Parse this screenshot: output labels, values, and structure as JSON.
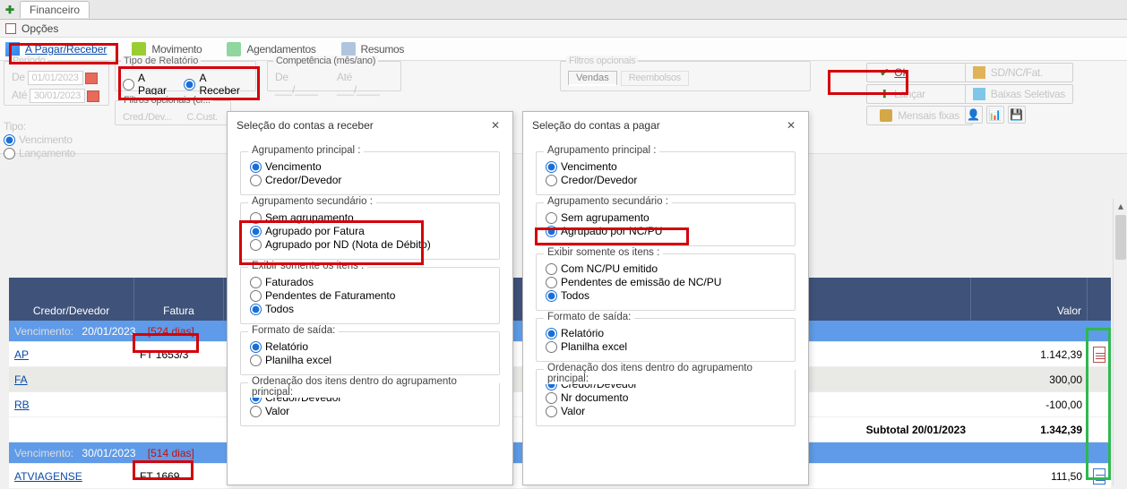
{
  "app": {
    "tab_title": "Financeiro"
  },
  "menu": {
    "opcoes": "Opções"
  },
  "toolbar": {
    "a_pagar_receber": "A Pagar/Receber",
    "movimento": "Movimento",
    "agendamentos": "Agendamentos",
    "resumos": "Resumos"
  },
  "filters": {
    "periodo_label": "Período",
    "de_label": "De",
    "ate_label": "Até",
    "tipo_label": "Tipo:",
    "de_value": "01/01/2023",
    "ate_value": "30/01/2023",
    "tipo_relatorio_label": "Tipo de Relatório",
    "a_pagar_opt": "A Pagar",
    "a_receber_opt": "A Receber",
    "competencia_label": "Competência (mês/ano)",
    "de2": "De  ___/____",
    "ate2": "Até  ___/____",
    "filtros_opcionais_label": "Filtros opcionais",
    "cred_dev": "Cred./Dev...",
    "ccust": "C.Cust.",
    "vencimento_opt": "Vencimento",
    "lancamento_opt": "Lançamento",
    "filtros_tabs": {
      "vendas": "Vendas",
      "reembolsos": "Reembolsos"
    }
  },
  "right_buttons": {
    "ok": "Ok",
    "lancar": "Lançar",
    "mensais_fixas": "Mensais fixas",
    "sd_nc": "SD/NC/Fat.",
    "baixas": "Baixas Seletivas"
  },
  "dialog_receber": {
    "title": "Seleção do contas a receber",
    "agrup_principal": "Agrupamento principal :",
    "vencimento": "Vencimento",
    "credor_devedor": "Credor/Devedor",
    "agrup_sec": "Agrupamento secundário :",
    "sem_agrup": "Sem agrupamento",
    "por_fatura": "Agrupado por Fatura",
    "por_nd": "Agrupado por ND (Nota de Débito)",
    "exibir": "Exibir somente os itens :",
    "faturados": "Faturados",
    "pend_fat": "Pendentes de Faturamento",
    "todos": "Todos",
    "formato": "Formato de saída:",
    "relatorio": "Relatório",
    "planilha": "Planilha excel",
    "ordenacao": "Ordenação dos itens dentro do agrupamento principal:",
    "ord_cd": "Credor/Devedor",
    "ord_valor": "Valor"
  },
  "dialog_pagar": {
    "title": "Seleção do contas a pagar",
    "agrup_principal": "Agrupamento principal :",
    "vencimento": "Vencimento",
    "credor_devedor": "Credor/Devedor",
    "agrup_sec": "Agrupamento secundário :",
    "sem_agrup": "Sem agrupamento",
    "por_ncpu": "Agrupado por NC/PU",
    "exibir": "Exibir somente os itens :",
    "com_ncpu": "Com NC/PU emitido",
    "pend_ncpu": "Pendentes de emissão de NC/PU",
    "todos": "Todos",
    "formato": "Formato de saída:",
    "relatorio": "Relatório",
    "planilha": "Planilha excel",
    "ordenacao": "Ordenação dos itens dentro do agrupamento principal:",
    "ord_cd": "Credor/Devedor",
    "ord_nrdoc": "Nr documento",
    "ord_valor": "Valor"
  },
  "grid": {
    "header": {
      "credor": "Credor/Devedor",
      "fatura": "Fatura",
      "valor": "Valor"
    },
    "group1": {
      "label": "Vencimento:",
      "date": "20/01/2023",
      "days": "[524 dias]"
    },
    "rows1": [
      {
        "cd": "AP",
        "ft": "FT 1653/3",
        "valor": "1.142,39"
      },
      {
        "cd": "FA",
        "ft": "",
        "valor": "300,00"
      },
      {
        "cd": "RB",
        "ft": "",
        "valor": "-100,00"
      }
    ],
    "subtotal1": {
      "label": "Subtotal 20/01/2023",
      "valor": "1.342,39"
    },
    "group2": {
      "label": "Vencimento:",
      "date": "30/01/2023",
      "days": "[514 dias]"
    },
    "rows2": [
      {
        "cd": "ATVIAGENSE",
        "ft": "FT 1669",
        "valor": "111,50"
      }
    ]
  }
}
